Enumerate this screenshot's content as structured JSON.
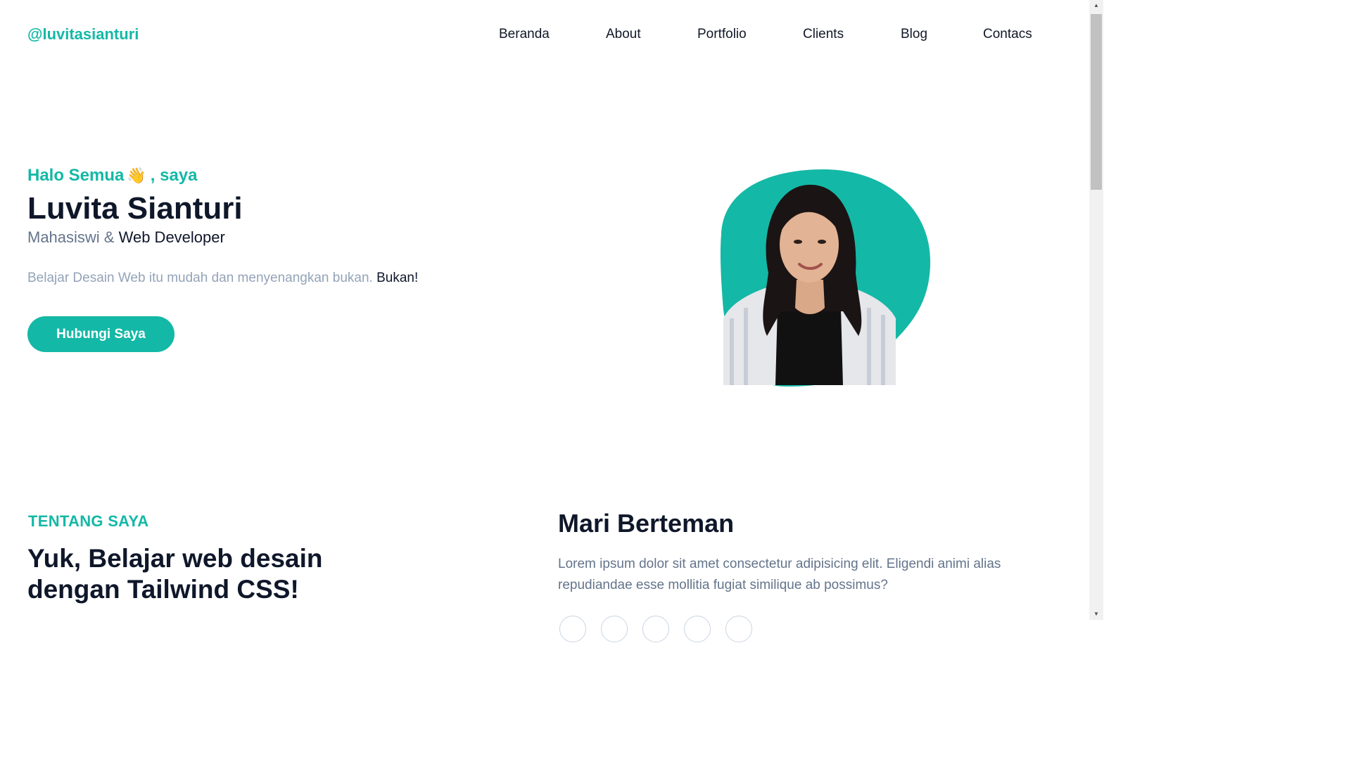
{
  "header": {
    "brand": "@luvitasianturi",
    "nav": [
      "Beranda",
      "About",
      "Portfolio",
      "Clients",
      "Blog",
      "Contacs"
    ]
  },
  "hero": {
    "greeting_prefix": "Halo Semua",
    "greeting_emoji": "👋",
    "greeting_suffix": ", saya",
    "name": "Luvita Sianturi",
    "role_part1": "Mahasiswi &",
    "role_part2": "Web Developer",
    "desc_part1": "Belajar Desain Web itu mudah dan menyenangkan bukan.",
    "desc_part2": "Bukan!",
    "cta_label": "Hubungi Saya"
  },
  "about": {
    "eyebrow": "TENTANG SAYA",
    "title": "Yuk, Belajar web desain dengan Tailwind CSS!"
  },
  "friends": {
    "title": "Mari Berteman",
    "text": "Lorem ipsum dolor sit amet consectetur adipisicing elit. Eligendi animi alias repudiandae esse mollitia fugiat similique ab possimus?",
    "social_count": 5
  },
  "colors": {
    "accent": "#14b8a6",
    "heading": "#0f172a",
    "muted": "#64748b",
    "light_muted": "#94a3b8"
  },
  "icons": [
    "waving-hand-icon",
    "scroll-up-arrow-icon",
    "scroll-down-arrow-icon"
  ]
}
